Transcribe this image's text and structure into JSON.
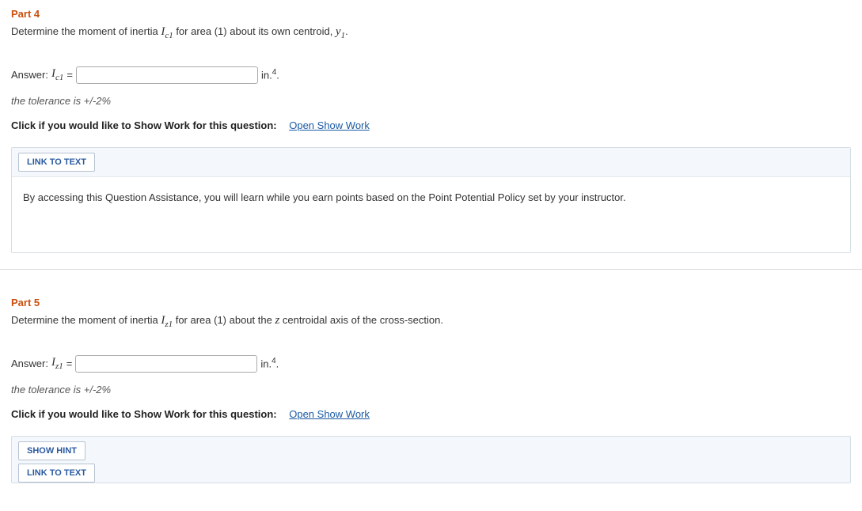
{
  "part4": {
    "title": "Part 4",
    "prompt_pre": "Determine the moment of inertia ",
    "var1": "I",
    "var1_sub": "c1",
    "prompt_mid": " for area (1) about its own centroid, ",
    "var2": "y",
    "var2_sub": "1",
    "prompt_end": ".",
    "answer_label": "Answer: ",
    "ans_var": "I",
    "ans_sub": "c1",
    "equals": " = ",
    "unit_pre": " in.",
    "unit_sup": "4",
    "unit_post": ".",
    "tolerance": "the tolerance is +/-2%",
    "show_work_label": "Click if you would like to Show Work for this question:",
    "show_work_link": "Open Show Work",
    "link_text_btn": "LINK TO TEXT",
    "assist_text": "By accessing this Question Assistance, you will learn while you earn points based on the Point Potential Policy set by your instructor."
  },
  "part5": {
    "title": "Part 5",
    "prompt_pre": "Determine the moment of inertia ",
    "var1": "I",
    "var1_sub": "z1",
    "prompt_mid": " for area (1) about the ",
    "var2": "z",
    "prompt_mid2": " centroidal axis of the cross-section.",
    "answer_label": "Answer: ",
    "ans_var": "I",
    "ans_sub": "z1",
    "equals": " = ",
    "unit_pre": " in.",
    "unit_sup": "4",
    "unit_post": ".",
    "tolerance": "the tolerance is +/-2%",
    "show_work_label": "Click if you would like to Show Work for this question:",
    "show_work_link": "Open Show Work",
    "show_hint_btn": "SHOW HINT",
    "link_text_btn": "LINK TO TEXT"
  }
}
